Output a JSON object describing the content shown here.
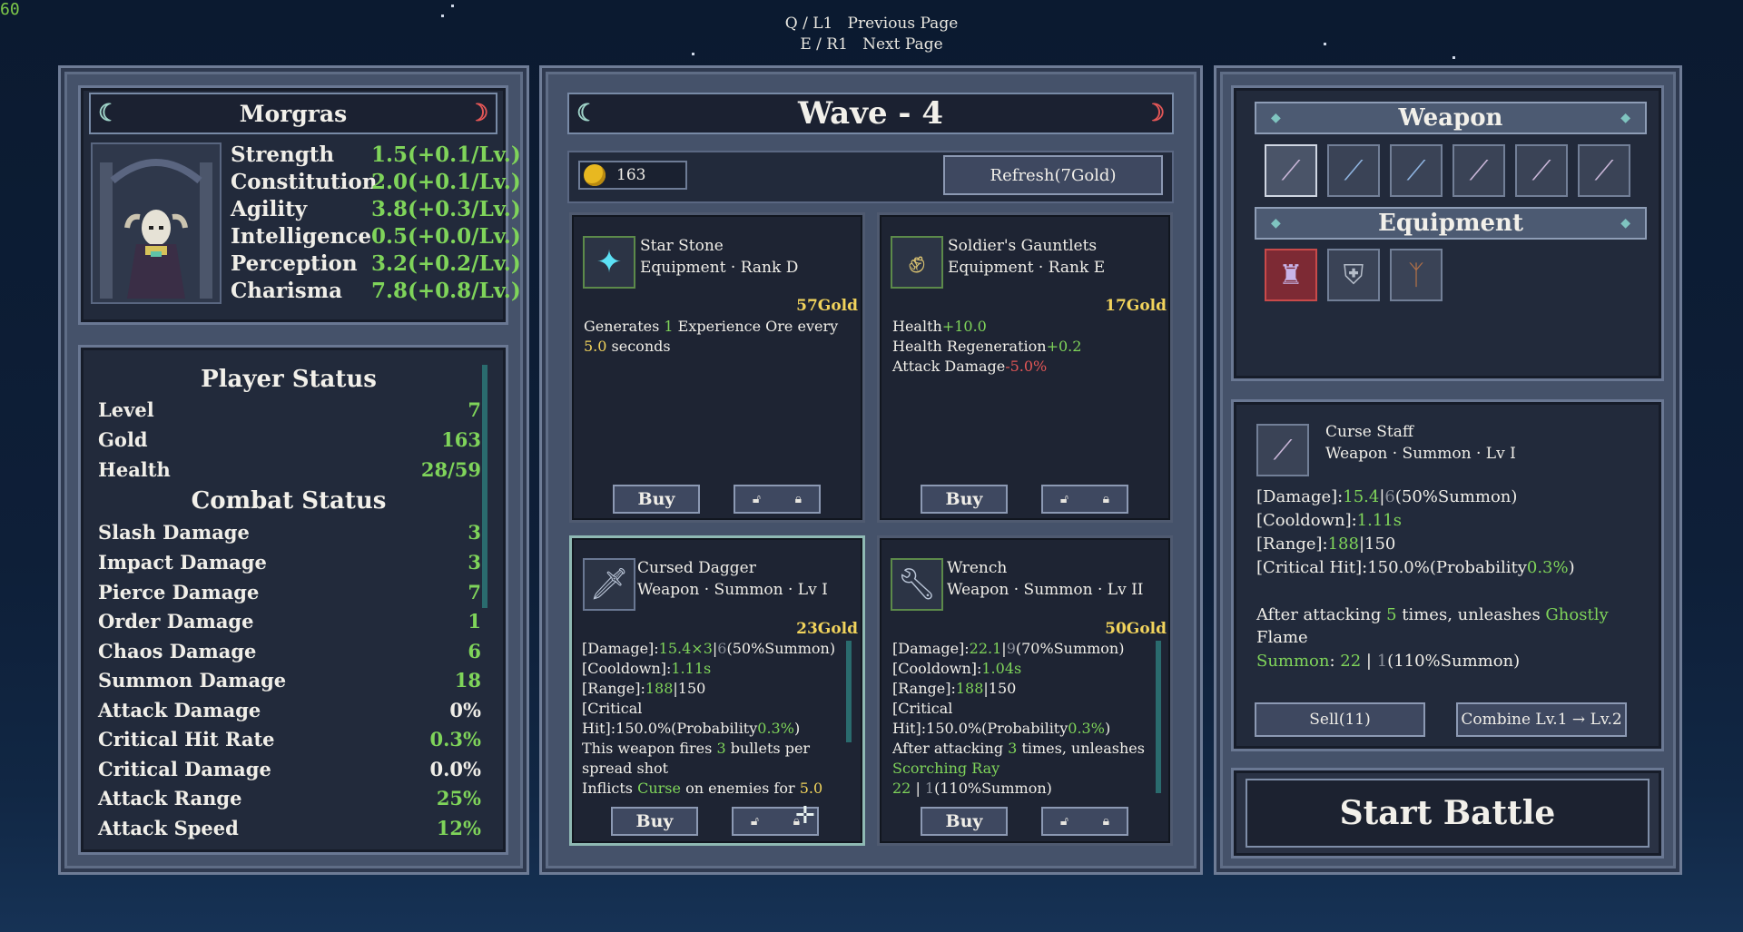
{
  "fps": "60",
  "hints": {
    "prev_key": "Q /  L1",
    "prev_label": "Previous Page",
    "next_key": "E /  R1",
    "next_label": "Next Page"
  },
  "character": {
    "name": "Morgras",
    "stats": [
      {
        "name": "Strength",
        "value": "1.5(+0.1/Lv.)"
      },
      {
        "name": "Constitution",
        "value": "2.0(+0.1/Lv.)"
      },
      {
        "name": "Agility",
        "value": "3.8(+0.3/Lv.)"
      },
      {
        "name": "Intelligence",
        "value": "0.5(+0.0/Lv.)"
      },
      {
        "name": "Perception",
        "value": "3.2(+0.2/Lv.)"
      },
      {
        "name": "Charisma",
        "value": "7.8(+0.8/Lv.)"
      }
    ]
  },
  "player_status": {
    "title": "Player Status",
    "rows": [
      {
        "name": "Level",
        "value": "7"
      },
      {
        "name": "Gold",
        "value": "163"
      },
      {
        "name": "Health",
        "value": "28/59"
      }
    ],
    "combat_title": "Combat Status",
    "combat_rows": [
      {
        "name": "Slash Damage",
        "value": "3"
      },
      {
        "name": "Impact Damage",
        "value": "3"
      },
      {
        "name": "Pierce Damage",
        "value": "7"
      },
      {
        "name": "Order Damage",
        "value": "1"
      },
      {
        "name": "Chaos Damage",
        "value": "6"
      },
      {
        "name": "Summon Damage",
        "value": "18"
      },
      {
        "name": "Attack Damage",
        "value": "0%"
      },
      {
        "name": "Critical Hit Rate",
        "value": "0.3%"
      },
      {
        "name": "Critical Damage",
        "value": "0.0%"
      },
      {
        "name": "Attack Range",
        "value": "25%"
      },
      {
        "name": "Attack Speed",
        "value": "12%"
      }
    ]
  },
  "shop": {
    "title": "Wave - 4",
    "gold": "163",
    "refresh_label": "Refresh(7Gold)",
    "buy_label": "Buy",
    "cards": [
      {
        "name": "Star Stone",
        "type": "Equipment · Rank D",
        "price": "57Gold",
        "desc": {
          "a": "Generates ",
          "b": "1",
          "c": " Experience Ore every ",
          "d": "5.0",
          "e": " seconds"
        }
      },
      {
        "name": "Soldier's Gauntlets",
        "type": "Equipment · Rank E",
        "price": "17Gold",
        "lines": [
          {
            "label": "Health",
            "value": "+10.0"
          },
          {
            "label": "Health Regeneration",
            "value": "+0.2"
          },
          {
            "label": "Attack Damage",
            "value": "-5.0%"
          }
        ]
      },
      {
        "name": "Cursed Dagger",
        "type": "Weapon · Summon · Lv I",
        "price": "23Gold",
        "damage": "15.4×3",
        "damage_alt": "6",
        "damage_suffix": "(50%Summon)",
        "cooldown": "1.11s",
        "range": "188",
        "range_alt": "150",
        "crit_a": "[Critical",
        "crit_b": "Hit]:150.0%(Probability",
        "crit_prob": "0.3%",
        "extra_a": "This weapon fires ",
        "extra_b": "3",
        "extra_c": " bullets per",
        "extra_d": "spread shot",
        "extra_e": "Inflicts ",
        "extra_f": "Curse",
        "extra_g": " on enemies for ",
        "extra_h": "5.0"
      },
      {
        "name": "Wrench",
        "type": "Weapon · Summon · Lv II",
        "price": "50Gold",
        "damage": "22.1",
        "damage_alt": "9",
        "damage_suffix": "(70%Summon)",
        "cooldown": "1.04s",
        "range": "188",
        "range_alt": "150",
        "crit_a": "[Critical",
        "crit_b": "Hit]:150.0%(Probability",
        "crit_prob": "0.3%",
        "extra_a": "After attacking ",
        "extra_b": "3",
        "extra_c": " times, unleashes",
        "extra_d": "Scorching Ray",
        "extra_e": "22",
        "extra_f": " | ",
        "extra_g": "1",
        "extra_h": "(110%Summon)"
      }
    ]
  },
  "inventory": {
    "weapon_title": "Weapon",
    "equipment_title": "Equipment",
    "weapons": [
      "staff-icon",
      "sword-icon",
      "sword-icon",
      "staff-icon",
      "staff-icon",
      "staff-icon"
    ],
    "equipment": [
      "robe-icon",
      "armor-icon",
      "branch-icon"
    ]
  },
  "detail": {
    "name": "Curse Staff",
    "type": "Weapon · Summon · Lv I",
    "damage": "15.4",
    "damage_alt": "6",
    "damage_suffix": "(50%Summon)",
    "cooldown": "1.11s",
    "range": "188",
    "range_alt": "150",
    "crit": "[Critical Hit]:150.0%(Probability",
    "crit_prob": "0.3%",
    "after_a": "After attacking ",
    "after_b": "5",
    "after_c": " times, unleashes ",
    "after_d": "Ghostly",
    "after_e": "Flame",
    "summon_label": "Summon",
    "summon_value": "22",
    "summon_alt": "1",
    "summon_suffix": "(110%Summon)",
    "sell_label": "Sell(11)",
    "combine_label": "Combine Lv.1 → Lv.2"
  },
  "start_battle_label": "Start Battle",
  "colors": {
    "accent_green": "#7fd45a",
    "gold": "#f1d35c",
    "negative": "#e25656"
  }
}
